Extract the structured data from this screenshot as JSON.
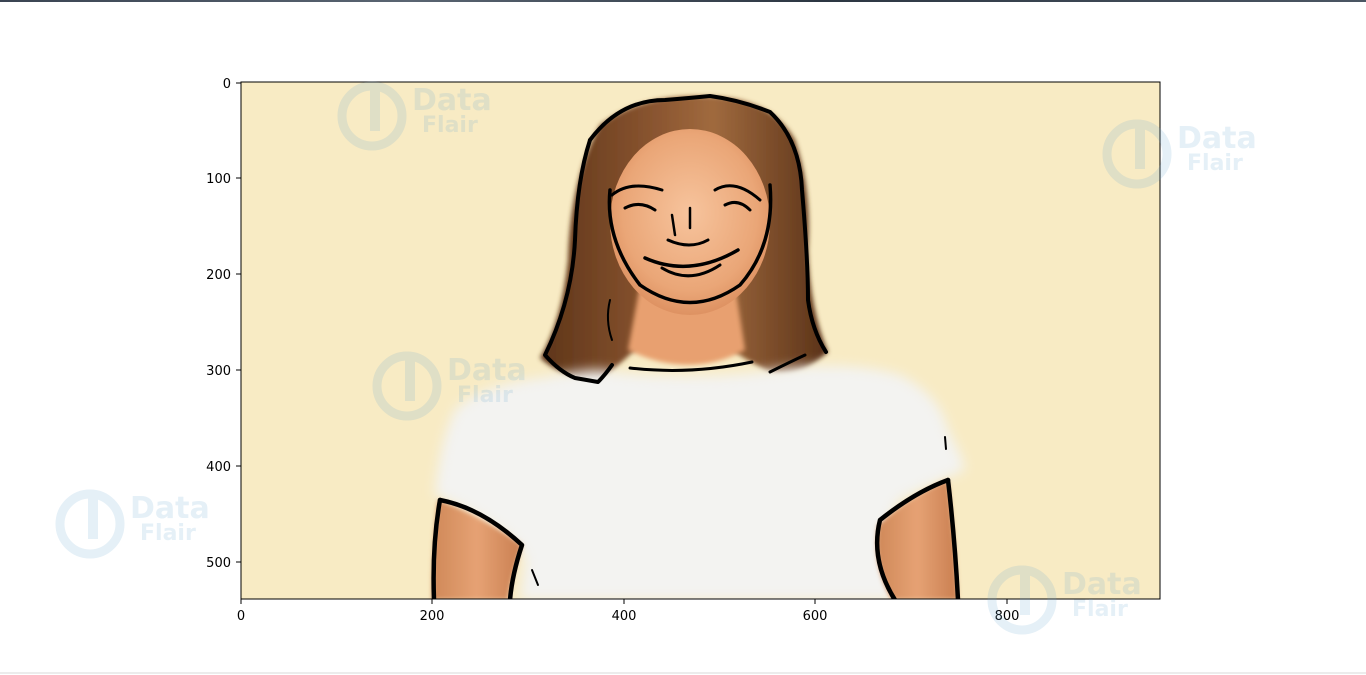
{
  "watermark": {
    "line1": "Data",
    "line2": "Flair"
  },
  "axes": {
    "x_ticks": [
      "0",
      "200",
      "400",
      "600",
      "800"
    ],
    "y_ticks": [
      "0",
      "100",
      "200",
      "300",
      "400",
      "500"
    ]
  },
  "colors": {
    "background": "#f8ebc4",
    "hair": "#7a4a25",
    "skin": "#e8a070",
    "shirt": "#f3f3f1",
    "outline": "#000000",
    "watermark": "#6aa7cf"
  }
}
